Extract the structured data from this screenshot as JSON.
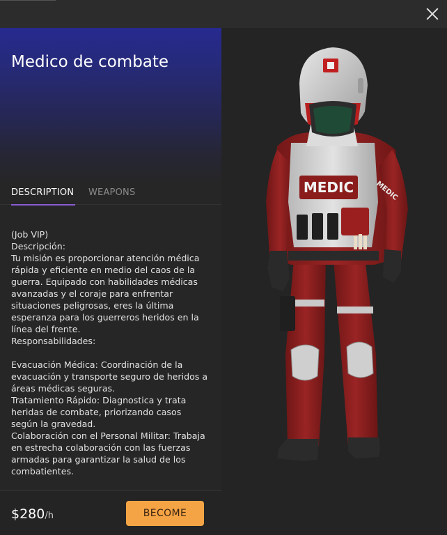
{
  "header": {
    "close_icon": "close-icon"
  },
  "job": {
    "title": "Medico de combate",
    "hero_gradient": [
      "#272a8f",
      "#262626"
    ]
  },
  "tabs": [
    {
      "label": "DESCRIPTION",
      "active": true
    },
    {
      "label": "WEAPONS",
      "active": false
    }
  ],
  "description": "(Job VIP)\nDescripción:\nTu misión es proporcionar atención médica rápida y eficiente en medio del caos de la guerra. Equipado con habilidades médicas avanzadas y el coraje para enfrentar situaciones peligrosas, eres la última esperanza para los guerreros heridos en la línea del frente.\nResponsabilidades:\n\nEvacuación Médica: Coordinación de la evacuación y transporte seguro de heridos a áreas médicas seguras.\nTratamiento Rápido: Diagnostica y trata heridas de combate, priorizando casos según la gravedad.\nColaboración con el Personal Militar: Trabaja en estrecha colaboración con las fuerzas armadas para garantizar la salud de los combatientes.",
  "footer": {
    "price": "$280",
    "price_unit": "/h",
    "become_label": "BECOME"
  },
  "model": {
    "vest_label": "MEDIC",
    "sleeve_label": "MEDIC"
  },
  "colors": {
    "accent_tab": "#8a5bd6",
    "button": "#f5a445",
    "suit_red": "#8e2020"
  }
}
